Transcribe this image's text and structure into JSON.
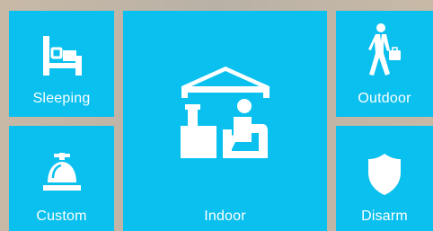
{
  "modes": {
    "sleeping": {
      "label": "Sleeping",
      "icon": "bed-icon"
    },
    "custom": {
      "label": "Custom",
      "icon": "service-bell-icon"
    },
    "indoor": {
      "label": "Indoor",
      "icon": "person-at-home-icon"
    },
    "outdoor": {
      "label": "Outdoor",
      "icon": "walking-person-with-briefcase-icon"
    },
    "disarm": {
      "label": "Disarm",
      "icon": "shield-icon"
    }
  },
  "colors": {
    "tile": "#0ac0ee",
    "icon": "#ffffff",
    "background": "#c8b9a6"
  }
}
